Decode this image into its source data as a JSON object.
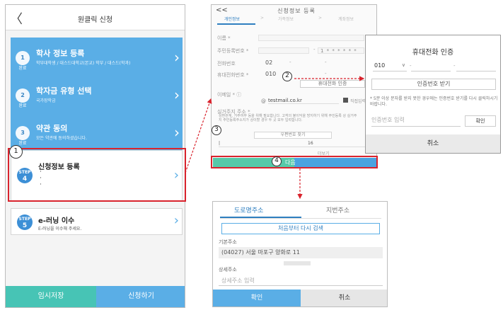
{
  "panel1": {
    "title": "원클릭 신청",
    "steps": [
      {
        "badge": "1",
        "badge_sub": "완료",
        "title": "학사 정보 등록",
        "subtitle": "학부대학생 / 대스드대학교(본교) 학부 / 대스드(학과)"
      },
      {
        "badge": "2",
        "badge_sub": "완료",
        "title": "학자금 유형 선택",
        "subtitle": "국가장학금"
      },
      {
        "badge": "3",
        "badge_sub": "완료",
        "title": "약관 동의",
        "subtitle": "모든 약관에 동의하셨습니다."
      }
    ],
    "step4": {
      "badge_top": "STEP",
      "badge_num": "4",
      "title": "신청정보 등록",
      "dots": [
        "·",
        "·",
        "·"
      ]
    },
    "step5": {
      "badge_top": "STEP",
      "badge_num": "5",
      "title": "e-러닝 이수",
      "subtitle": "E-러닝을 이수해 주세요."
    },
    "footer": {
      "save": "임시저장",
      "apply": "신청하기"
    },
    "back_glyph": "〈"
  },
  "panel2": {
    "back": "<<",
    "title": "신청정보 등록",
    "tabs": [
      "개인정보",
      ">",
      "가족정보",
      ">",
      "계좌정보"
    ],
    "fields": [
      {
        "label": "이름 *",
        "value": ""
      },
      {
        "label": "주민등록번호 *",
        "value": "-",
        "value2": "1 * * * * * *"
      },
      {
        "label": "전화번호",
        "value": "02",
        "sep": "-",
        "sep2": "-"
      },
      {
        "label": "휴대전화번호 *",
        "value": "010",
        "sep": "-",
        "sep2": "-"
      }
    ],
    "verify_button": "휴대전화 인증",
    "email_label": "이메일 * ⓘ",
    "email_at": "@",
    "email_value": "testmail.co.kr",
    "email_option": "직접입력",
    "address_label": "실거주지 주소 *",
    "address_note": "상환관계, 거주여부 등을 위해 필요합니다. 고객의 불이익을 방지하기 위해 주민등록 상 실거주지 주민등록주소지가 상이할 경우 두 곳 모두 입력합니다.",
    "zip_button": "우편번호 찾기",
    "addr_num": "16",
    "addr_more": "더보기",
    "next_button": "다음"
  },
  "panel3": {
    "title": "휴대전화 인증",
    "prefix": "010",
    "chevron": "∨",
    "dash1": "-",
    "dash2": "-",
    "request_button": "인증번호 받기",
    "notice": "* 5분 이상 문자를 받지 못한 경우에는 인증번호 받기를 다시 클릭하시기 바랍니다.",
    "code_placeholder": "인증번호 입력",
    "confirm_button": "확인",
    "cancel_button": "취소"
  },
  "panel4": {
    "tab_road": "도로명주소",
    "tab_lot": "지번주소",
    "retry_button": "처음부터 다시 검색",
    "basic_label": "기본주소",
    "basic_value": "(04027) 서울 마포구 양화로 11",
    "detail_label": "상세주소",
    "detail_placeholder": "상세주소 입력",
    "confirm_button": "확인",
    "cancel_button": "취소"
  },
  "markers": [
    "1",
    "2",
    "3",
    "4"
  ],
  "colors": {
    "step_blue": "#5aaee6",
    "footer_teal": "#47c4b5",
    "footer_blue": "#5aaee6",
    "highlight_red": "#d9232d",
    "next_teal": "#56c9a9",
    "next_blue": "#4aa3e0",
    "tab_blue": "#2f7fc0"
  }
}
